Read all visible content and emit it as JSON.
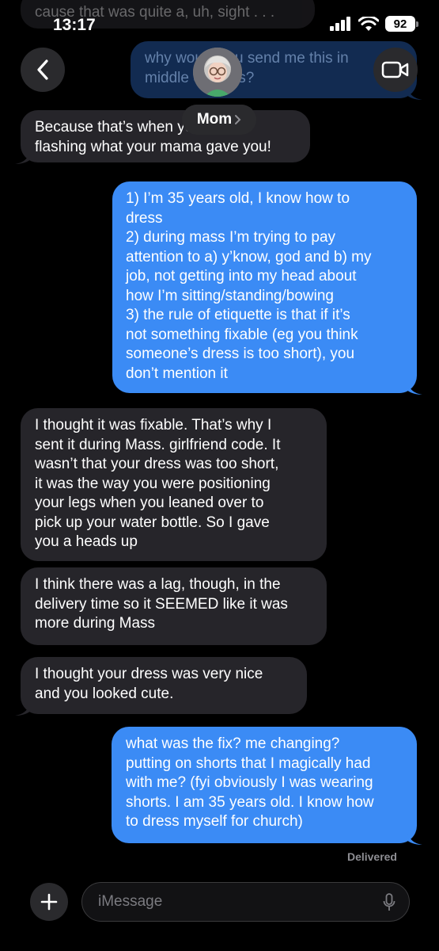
{
  "status_bar": {
    "time": "13:17",
    "battery": "92"
  },
  "header": {
    "contact_name": "Mom",
    "back_icon": "chevron-left-icon",
    "video_icon": "video-camera-icon"
  },
  "top_partial": {
    "received_tail": "cause that was quite a, uh, sight . . .",
    "sent_lines": [
      "why would you send me this in",
      "middle of mass?"
    ]
  },
  "messages": [
    {
      "from": "them",
      "lines": [
        "Because that’s when you were",
        "flashing what your mama gave you!"
      ]
    },
    {
      "from": "me",
      "lines": [
        "1) I’m 35 years old, I know how to",
        "dress",
        "2) during mass I’m trying to pay",
        "attention to a) y’know, god and b) my",
        "job, not getting into my head about",
        "how I’m sitting/standing/bowing",
        "3) the rule of etiquette is that if it’s",
        "not something fixable (eg you think",
        "someone’s dress is too short), you",
        "don’t mention it"
      ]
    },
    {
      "from": "them",
      "lines": [
        "I thought it was fixable.  That’s why I",
        "sent it during Mass. girlfriend code. It",
        "wasn’t that your dress was too short,",
        "it was the way you were positioning",
        "your legs when you leaned over to",
        "pick up your water bottle. So I gave",
        "you a heads up"
      ]
    },
    {
      "from": "them",
      "lines": [
        "I think there was a lag, though, in the",
        "delivery time so it SEEMED like it was",
        "more during Mass"
      ]
    },
    {
      "from": "them",
      "lines": [
        "I thought your dress was very nice",
        "and you looked cute."
      ]
    },
    {
      "from": "me",
      "lines": [
        "what was the fix? me changing?",
        "putting on shorts that I magically had",
        "with me? (fyi obviously I was wearing",
        "shorts. I am 35 years old. I know how",
        "to dress myself for church)"
      ]
    }
  ],
  "delivery_status": "Delivered",
  "composer": {
    "placeholder": "iMessage",
    "mic_icon": "microphone-icon",
    "plus_icon": "plus-icon"
  },
  "colors": {
    "sent_bubble": "#3b8bf5",
    "received_bubble": "#26252a",
    "background": "#000000"
  }
}
